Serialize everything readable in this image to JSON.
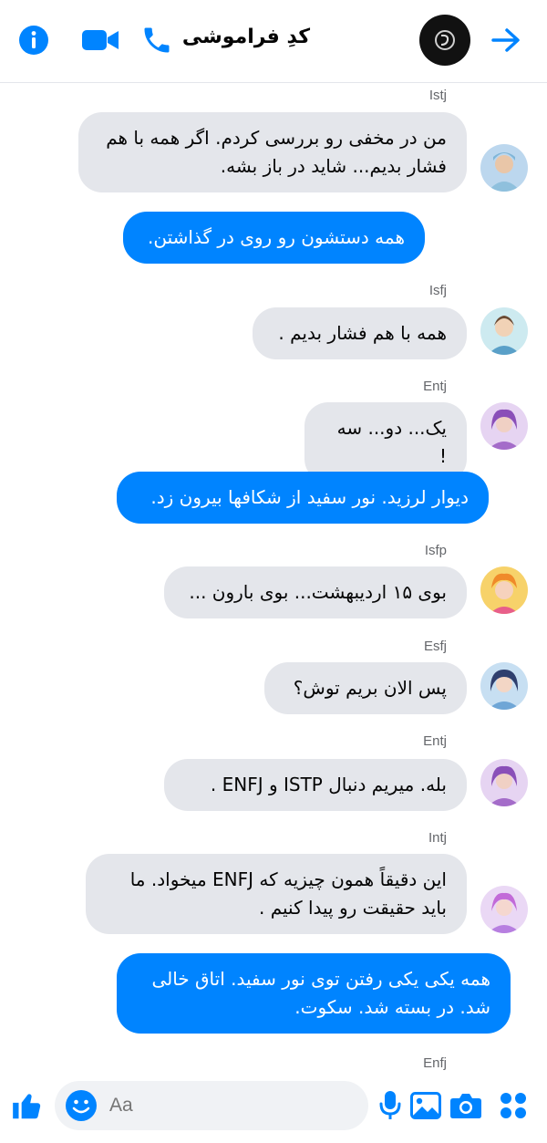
{
  "header": {
    "title": "کدِ فراموشی",
    "icons": [
      "info-icon",
      "video-call-icon",
      "phone-icon",
      "forward-arrow-icon"
    ]
  },
  "colors": {
    "accent": "#0084ff",
    "incoming": "#e4e6eb",
    "secondary_text": "#65676b"
  },
  "messages": [
    {
      "sender": "Istj",
      "text": "من در مخفی رو بررسی کردم. اگر همه با هم فشار بدیم... شاید در باز بشه."
    },
    {
      "sender": "",
      "text": "همه دستشون رو روی در گذاشتن."
    },
    {
      "sender": "Isfj",
      "text": "همه با هم فشار بدیم ."
    },
    {
      "sender": "Entj",
      "text": "یک... دو... سه !"
    },
    {
      "sender": "",
      "text": "دیوار لرزید. نور سفید از شکافها بیرون زد."
    },
    {
      "sender": "Isfp",
      "text": "بوی ۱۵ اردیبهشت... بوی بارون ..."
    },
    {
      "sender": "Esfj",
      "text": "پس الان بریم توش؟"
    },
    {
      "sender": "Entj",
      "text": "بله. میریم دنبال ISTP و ENFJ ."
    },
    {
      "sender": "Intj",
      "text": "این دقیقاً همون چیزیه که ENFJ میخواد. ما باید حقیقت رو پیدا کنیم ."
    },
    {
      "sender": "",
      "text": "همه یکی یکی رفتن توی نور سفید. اتاق خالی شد. در بسته شد. سکوت."
    },
    {
      "sender": "Enfj",
      "text": ""
    }
  ],
  "composer": {
    "placeholder": "Aa",
    "icons": [
      "apps-icon",
      "camera-icon",
      "gallery-icon",
      "microphone-icon",
      "emoji-icon",
      "like-icon"
    ]
  }
}
